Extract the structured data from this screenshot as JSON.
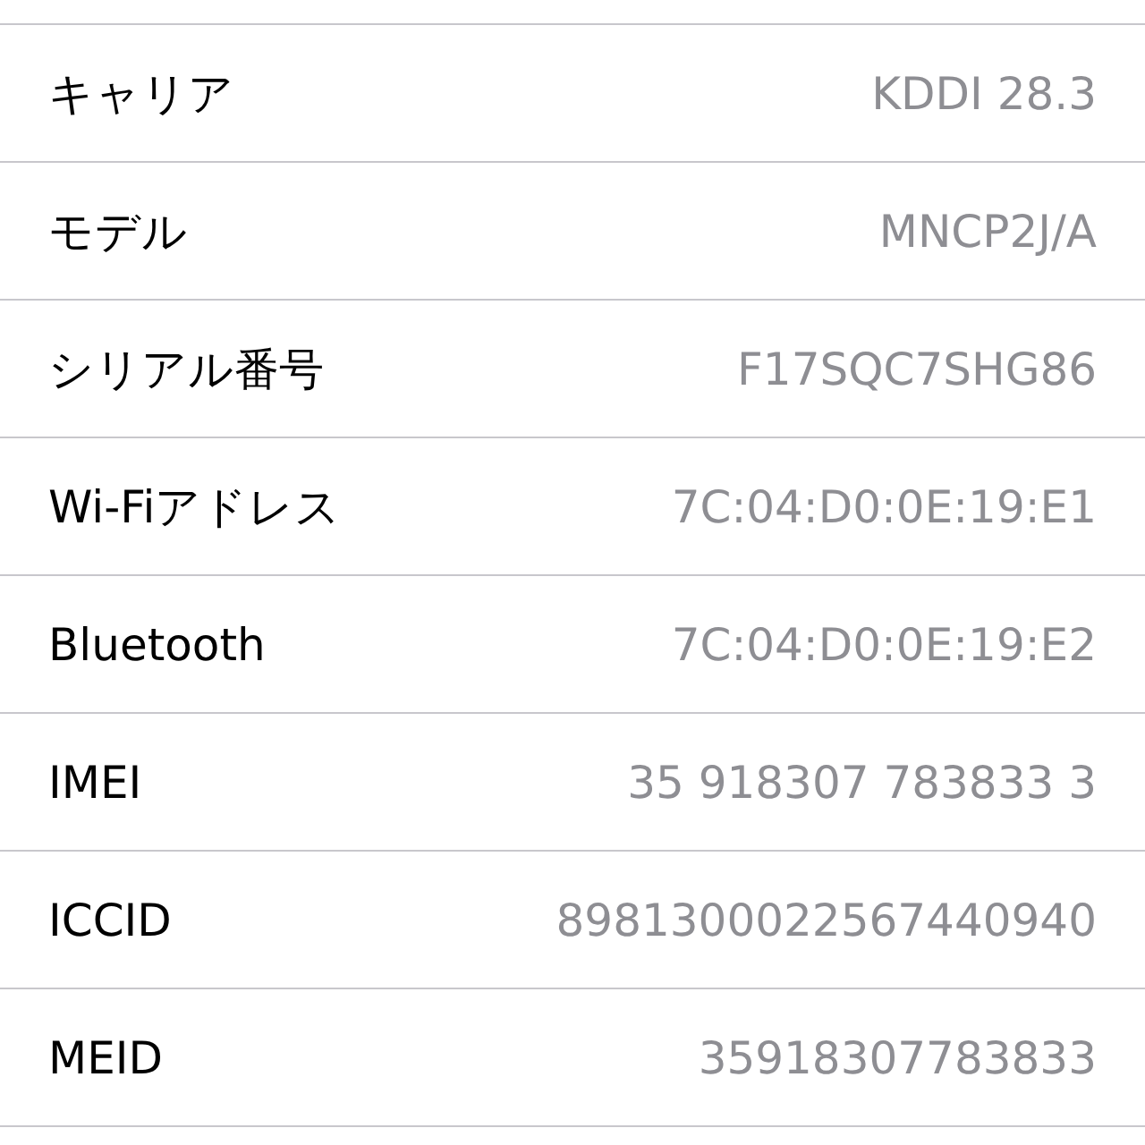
{
  "rows": [
    {
      "label": "キャリア",
      "value": "KDDI 28.3"
    },
    {
      "label": "モデル",
      "value": "MNCP2J/A"
    },
    {
      "label": "シリアル番号",
      "value": "F17SQC7SHG86"
    },
    {
      "label": "Wi-Fiアドレス",
      "value": "7C:04:D0:0E:19:E1"
    },
    {
      "label": "Bluetooth",
      "value": "7C:04:D0:0E:19:E2"
    },
    {
      "label": "IMEI",
      "value": "35 918307 783833 3"
    },
    {
      "label": "ICCID",
      "value": "8981300022567440940"
    },
    {
      "label": "MEID",
      "value": "35918307783833"
    }
  ]
}
